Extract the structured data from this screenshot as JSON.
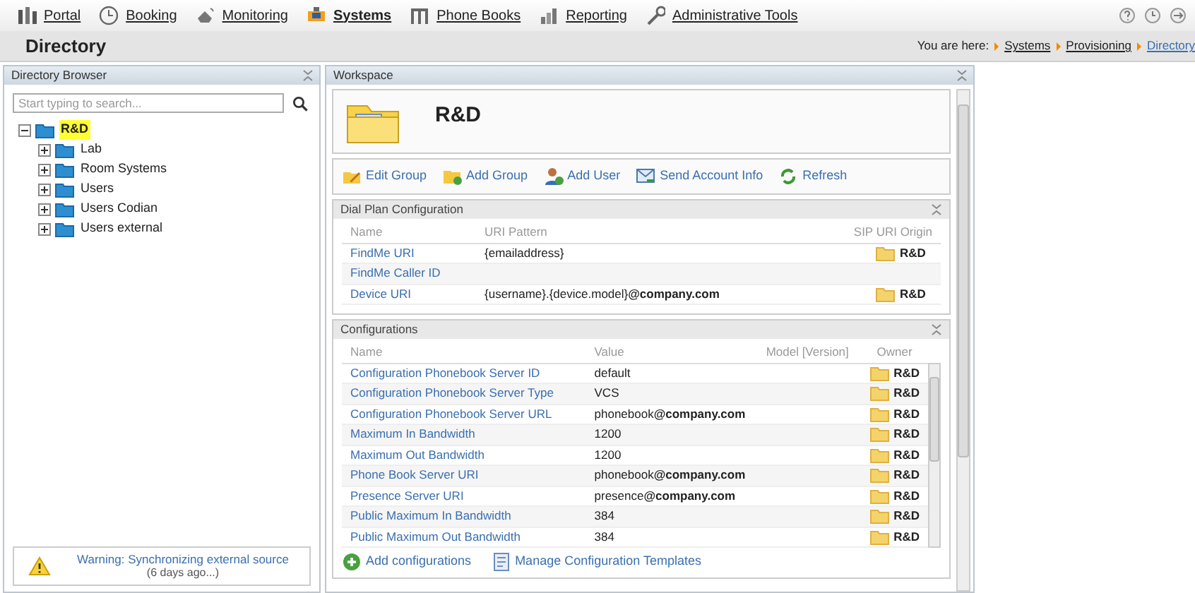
{
  "nav": {
    "items": [
      {
        "label": "Portal",
        "kind": "portal",
        "selected": false
      },
      {
        "label": "Booking",
        "kind": "booking",
        "selected": false
      },
      {
        "label": "Monitoring",
        "kind": "monitoring",
        "selected": false
      },
      {
        "label": "Systems",
        "kind": "systems",
        "selected": true
      },
      {
        "label": "Phone Books",
        "kind": "phonebooks",
        "selected": false
      },
      {
        "label": "Reporting",
        "kind": "reporting",
        "selected": false
      },
      {
        "label": "Administrative Tools",
        "kind": "admin",
        "selected": false
      }
    ]
  },
  "page_title": "Directory",
  "breadcrumb": {
    "prefix": "You are here:",
    "items": [
      {
        "label": "Systems",
        "current": false
      },
      {
        "label": "Provisioning",
        "current": false
      },
      {
        "label": "Directory",
        "current": true
      }
    ]
  },
  "directory_browser": {
    "title": "Directory Browser",
    "search": {
      "placeholder": "Start typing to search..."
    },
    "tree": [
      {
        "label": "R&D",
        "selected": true,
        "expanded": true,
        "children": [
          {
            "label": "Lab",
            "selected": false,
            "expanded": false
          },
          {
            "label": "Room Systems",
            "selected": false,
            "expanded": false
          },
          {
            "label": "Users",
            "selected": false,
            "expanded": false
          },
          {
            "label": "Users Codian",
            "selected": false,
            "expanded": false
          },
          {
            "label": "Users external",
            "selected": false,
            "expanded": false
          }
        ]
      }
    ],
    "warning": {
      "title": "Warning: Synchronizing external source",
      "detail": "(6 days ago...)"
    }
  },
  "workspace": {
    "title": "Workspace",
    "group_name": "R&D",
    "actions": [
      {
        "label": "Edit Group",
        "kind": "edit"
      },
      {
        "label": "Add Group",
        "kind": "add_group"
      },
      {
        "label": "Add User",
        "kind": "add_user"
      },
      {
        "label": "Send Account Info",
        "kind": "send"
      },
      {
        "label": "Refresh",
        "kind": "refresh"
      }
    ],
    "dial_plan": {
      "title": "Dial Plan Configuration",
      "columns": [
        "Name",
        "URI Pattern",
        "SIP URI Origin"
      ],
      "rows": [
        {
          "name": "FindMe URI",
          "pattern": "{emailaddress}",
          "origin": "R&D"
        },
        {
          "name": "FindMe Caller ID"
        },
        {
          "name": "Device URI",
          "pattern": "{username}.{device.model}**@company.com**",
          "origin": "R&D"
        }
      ]
    },
    "configurations": {
      "title": "Configurations",
      "columns": [
        "Name",
        "Value",
        "Model [Version]",
        "Owner"
      ],
      "rows": [
        {
          "name": "Configuration Phonebook Server ID",
          "value": "default",
          "owner": "R&D"
        },
        {
          "name": "Configuration Phonebook Server Type",
          "value": "VCS",
          "owner": "R&D"
        },
        {
          "name": "Configuration Phonebook Server URL",
          "value": "phonebook**@company.com**",
          "owner": "R&D"
        },
        {
          "name": "Maximum In Bandwidth",
          "value": "1200",
          "owner": "R&D"
        },
        {
          "name": "Maximum Out Bandwidth",
          "value": "1200",
          "owner": "R&D"
        },
        {
          "name": "Phone Book Server URI",
          "value": "phonebook**@company.com**",
          "owner": "R&D"
        },
        {
          "name": "Presence Server URI",
          "value": "presence**@company.com**",
          "owner": "R&D"
        },
        {
          "name": "Public Maximum In Bandwidth",
          "value": "384",
          "owner": "R&D"
        },
        {
          "name": "Public Maximum Out Bandwidth",
          "value": "384",
          "owner": "R&D"
        }
      ],
      "footer_actions": [
        {
          "label": "Add configurations",
          "kind": "add"
        },
        {
          "label": "Manage Configuration Templates",
          "kind": "template"
        }
      ]
    }
  }
}
